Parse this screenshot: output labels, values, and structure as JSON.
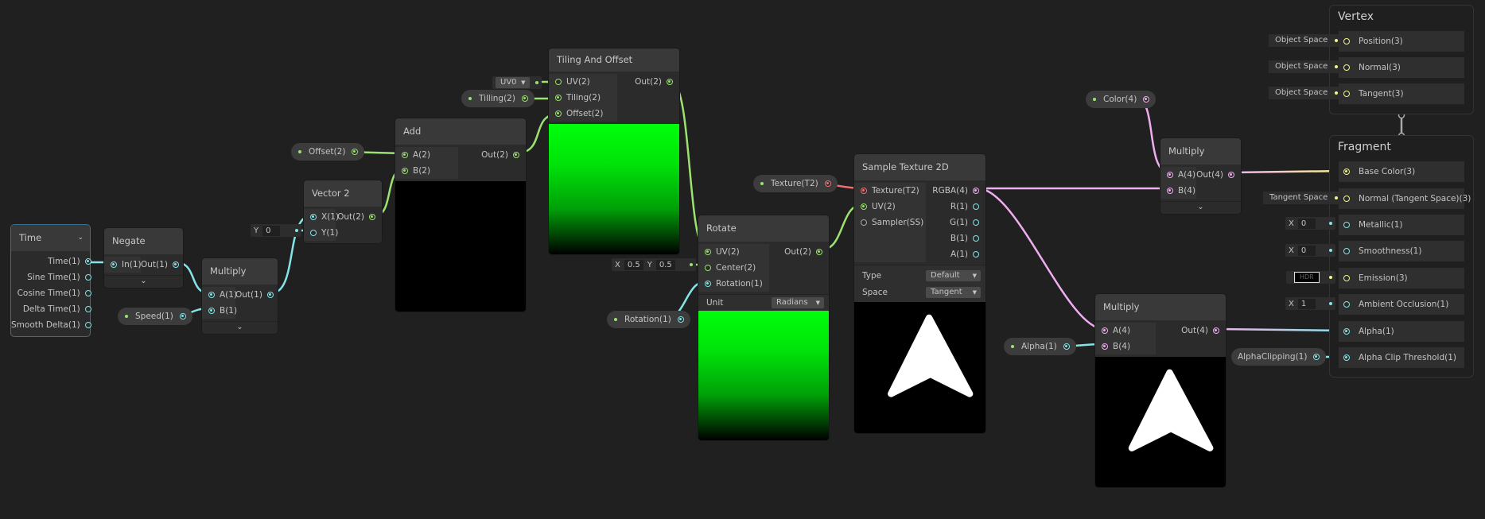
{
  "colors": {
    "canvas": "#202020",
    "vector1": "#84e4e7",
    "vector2": "#9be26f",
    "vector3": "#f3f38c",
    "vector4": "#f0aef0",
    "texture": "#f07171",
    "preview_green": "#00ff0a"
  },
  "nodes": {
    "time": {
      "title": "Time",
      "outputs": [
        "Time(1)",
        "Sine Time(1)",
        "Cosine Time(1)",
        "Delta Time(1)",
        "Smooth Delta(1)"
      ]
    },
    "negate": {
      "title": "Negate",
      "inputs": [
        "In(1)"
      ],
      "outputs": [
        "Out(1)"
      ]
    },
    "multiply_speed": {
      "title": "Multiply",
      "inputs": [
        "A(1)",
        "B(1)"
      ],
      "outputs": [
        "Out(1)"
      ]
    },
    "vector2": {
      "title": "Vector 2",
      "inputs": [
        "X(1)",
        "Y(1)"
      ],
      "outputs": [
        "Out(2)"
      ],
      "y_default": {
        "label": "Y",
        "value": "0"
      }
    },
    "add": {
      "title": "Add",
      "inputs": [
        "A(2)",
        "B(2)"
      ],
      "outputs": [
        "Out(2)"
      ]
    },
    "tiling_offset": {
      "title": "Tiling And Offset",
      "inputs": [
        "UV(2)",
        "Tiling(2)",
        "Offset(2)"
      ],
      "outputs": [
        "Out(2)"
      ],
      "uv_default": "UV0"
    },
    "rotate": {
      "title": "Rotate",
      "inputs": [
        "UV(2)",
        "Center(2)",
        "Rotation(1)"
      ],
      "outputs": [
        "Out(2)"
      ],
      "center_default": {
        "x_label": "X",
        "x": "0.5",
        "y_label": "Y",
        "y": "0.5"
      },
      "unit_label": "Unit",
      "unit_value": "Radians"
    },
    "sample_texture": {
      "title": "Sample Texture 2D",
      "inputs": [
        "Texture(T2)",
        "UV(2)",
        "Sampler(SS)"
      ],
      "outputs": [
        "RGBA(4)",
        "R(1)",
        "G(1)",
        "B(1)",
        "A(1)"
      ],
      "type_label": "Type",
      "type_value": "Default",
      "space_label": "Space",
      "space_value": "Tangent"
    },
    "multiply_color": {
      "title": "Multiply",
      "inputs": [
        "A(4)",
        "B(4)"
      ],
      "outputs": [
        "Out(4)"
      ]
    },
    "multiply_alpha": {
      "title": "Multiply",
      "inputs": [
        "A(4)",
        "B(4)"
      ],
      "outputs": [
        "Out(4)"
      ]
    }
  },
  "properties": {
    "offset": "Offset(2)",
    "tilling": "Tilling(2)",
    "texture": "Texture(T2)",
    "speed": "Speed(1)",
    "rotation": "Rotation(1)",
    "color": "Color(4)",
    "alpha": "Alpha(1)",
    "alpha_clipping": "AlphaClipping(1)"
  },
  "master": {
    "vertex": {
      "title": "Vertex",
      "rows": [
        {
          "label": "Position(3)",
          "default": "Object Space"
        },
        {
          "label": "Normal(3)",
          "default": "Object Space"
        },
        {
          "label": "Tangent(3)",
          "default": "Object Space"
        }
      ]
    },
    "fragment": {
      "title": "Fragment",
      "rows": [
        {
          "label": "Base Color(3)"
        },
        {
          "label": "Normal (Tangent Space)(3)",
          "default": "Tangent Space"
        },
        {
          "label": "Metallic(1)",
          "x_label": "X",
          "default": "0"
        },
        {
          "label": "Smoothness(1)",
          "x_label": "X",
          "default": "0"
        },
        {
          "label": "Emission(3)",
          "default": "HDR"
        },
        {
          "label": "Ambient Occlusion(1)",
          "x_label": "X",
          "default": "1"
        },
        {
          "label": "Alpha(1)"
        },
        {
          "label": "Alpha Clip Threshold(1)"
        }
      ]
    }
  }
}
